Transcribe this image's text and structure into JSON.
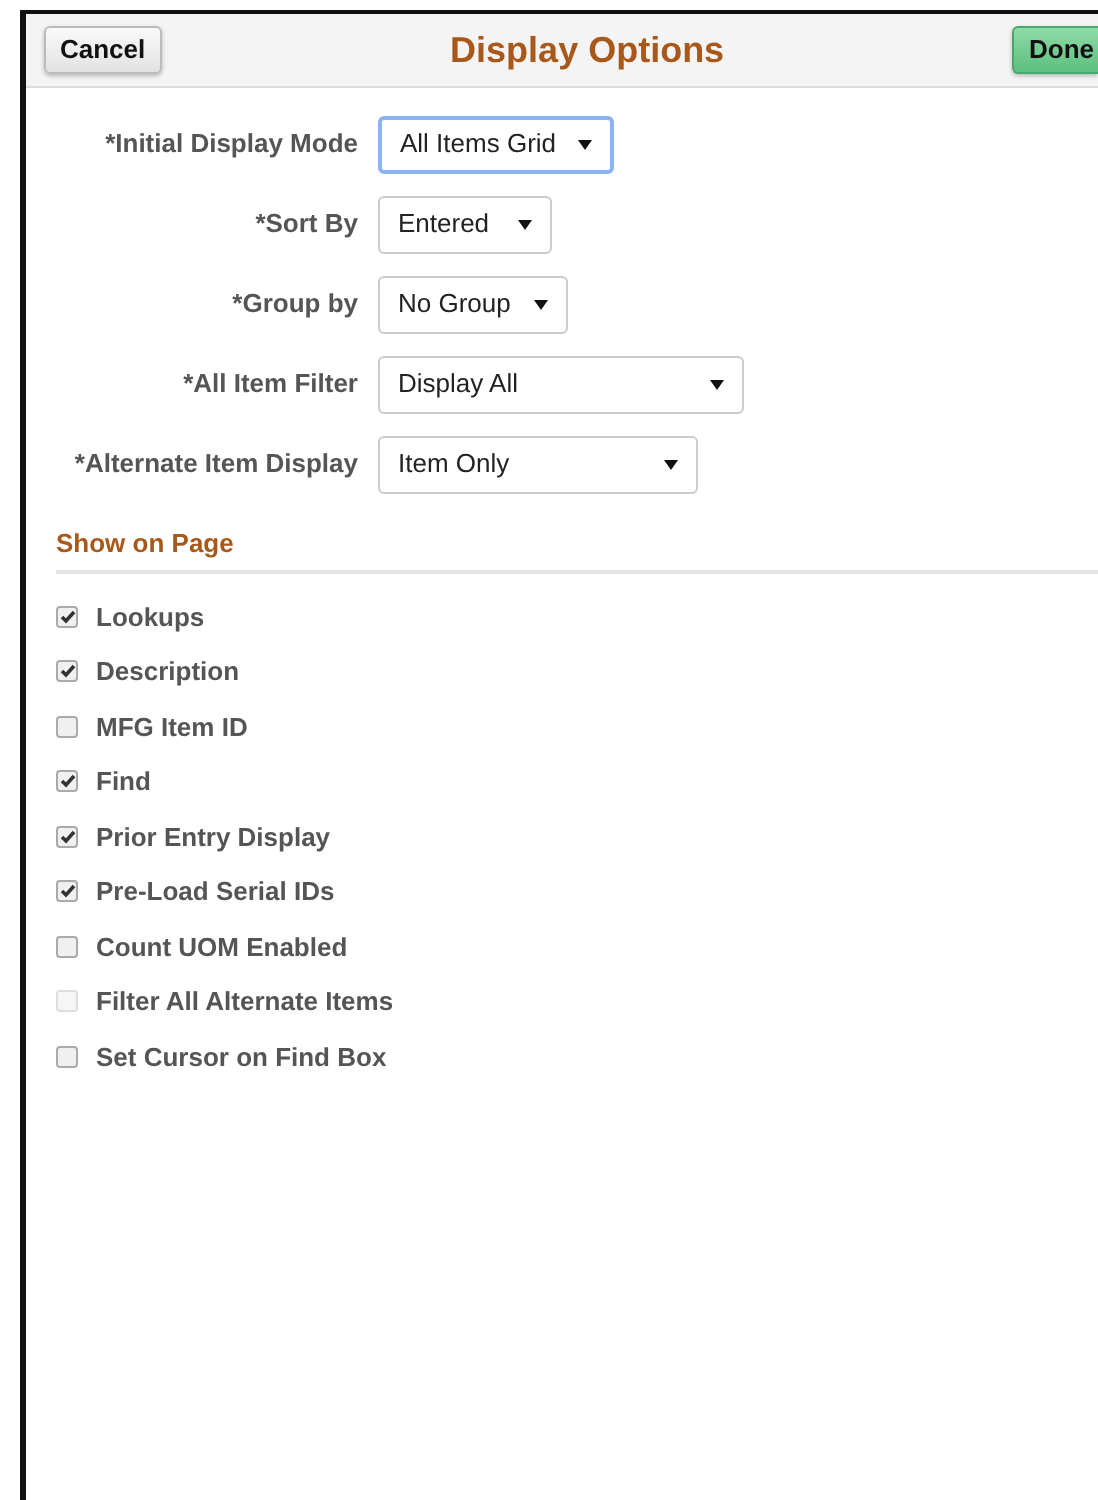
{
  "header": {
    "cancel": "Cancel",
    "title": "Display Options",
    "done": "Done"
  },
  "fields": [
    {
      "label": "*Initial Display Mode",
      "value": "All Items Grid",
      "focused": true
    },
    {
      "label": "*Sort By",
      "value": "Entered",
      "focused": false
    },
    {
      "label": "*Group by",
      "value": "No Group",
      "focused": false
    },
    {
      "label": "*All Item Filter",
      "value": "Display All",
      "focused": false
    },
    {
      "label": "*Alternate Item Display",
      "value": "Item Only",
      "focused": false
    }
  ],
  "section": {
    "title": "Show on Page"
  },
  "options": [
    {
      "label": "Lookups",
      "checked": true,
      "disabled": false
    },
    {
      "label": "Description",
      "checked": true,
      "disabled": false
    },
    {
      "label": "MFG Item ID",
      "checked": false,
      "disabled": false
    },
    {
      "label": "Find",
      "checked": true,
      "disabled": false
    },
    {
      "label": "Prior Entry Display",
      "checked": true,
      "disabled": false
    },
    {
      "label": "Pre-Load Serial IDs",
      "checked": true,
      "disabled": false
    },
    {
      "label": "Count UOM Enabled",
      "checked": false,
      "disabled": false
    },
    {
      "label": "Filter All Alternate Items",
      "checked": false,
      "disabled": true
    },
    {
      "label": "Set Cursor on Find Box",
      "checked": false,
      "disabled": false
    }
  ]
}
